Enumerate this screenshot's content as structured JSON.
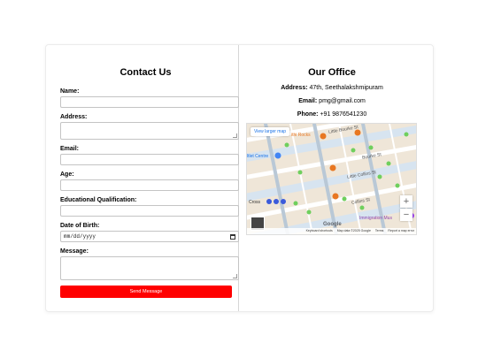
{
  "contact": {
    "title": "Contact Us",
    "fields": {
      "name_label": "Name:",
      "address_label": "Address:",
      "email_label": "Email:",
      "age_label": "Age:",
      "education_label": "Educational Qualification:",
      "dob_label": "Date of Birth:",
      "dob_placeholder": "mm/dd/yyyy",
      "message_label": "Message:"
    },
    "send_label": "Send Message"
  },
  "office": {
    "title": "Our Office",
    "address_label": "Address:",
    "address_value": "47th, Seethalakshmipuram",
    "email_label": "Email:",
    "email_value": "pmg@gmail.com",
    "phone_label": "Phone:",
    "phone_value": "+91 9876541230"
  },
  "map": {
    "view_larger": "View larger map",
    "labels": {
      "hard_rock": "ithi Rocks",
      "little_bourke": "Little Bourke St",
      "bourke": "Bourke St",
      "little_collins": "Little Collins St",
      "collins": "Collins St",
      "centre": "ltlet Centre",
      "immigration": "Immigration Mus",
      "cross": "Cross"
    },
    "zoom_in": "+",
    "zoom_out": "−",
    "google": "Google",
    "footer": {
      "shortcuts": "Keyboard shortcuts",
      "data": "Map data ©2025 Google",
      "terms": "Terms",
      "report": "Report a map error"
    }
  },
  "colors": {
    "send_button": "#ff0000",
    "map_bg": "#efe6d8",
    "street": "#ffffff",
    "poi": "#e87722"
  }
}
